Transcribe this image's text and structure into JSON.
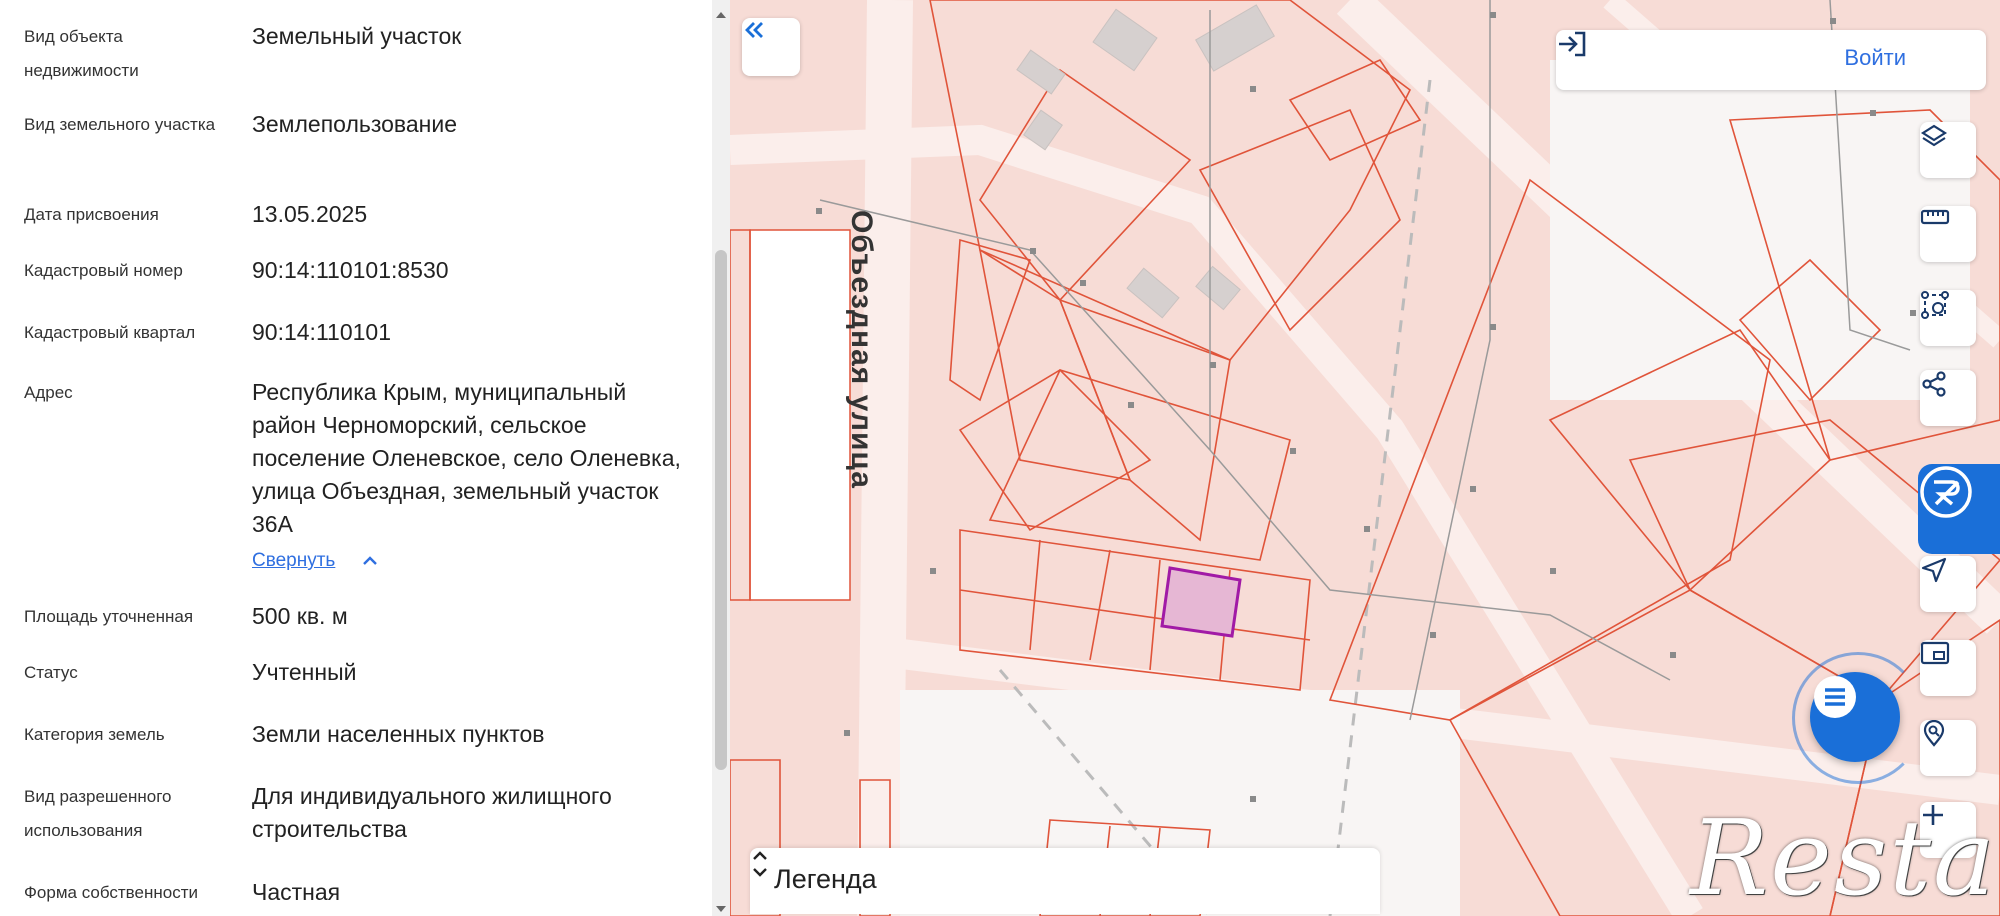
{
  "panel": {
    "rows": [
      {
        "label": "Вид объекта недвижимости",
        "value": "Земельный участок"
      },
      {
        "label": "Вид земельного участка",
        "value": "Землепользование"
      },
      {
        "label": "Дата присвоения",
        "value": "13.05.2025"
      },
      {
        "label": "Кадастровый номер",
        "value": "90:14:110101:8530"
      },
      {
        "label": "Кадастровый квартал",
        "value": "90:14:110101"
      },
      {
        "label": "Адрес",
        "value": "Республика Крым, муниципальный район Черноморский, сельское поселение Оленевское, село Оленевка, улица Объездная, земельный участок 36А"
      },
      {
        "label": "Площадь уточненная",
        "value": "500 кв. м"
      },
      {
        "label": "Статус",
        "value": "Учтенный"
      },
      {
        "label": "Категория земель",
        "value": "Земли населенных пунктов"
      },
      {
        "label": "Вид разрешенного использования",
        "value": "Для индивидуального жилищного строительства"
      },
      {
        "label": "Форма собственности",
        "value": "Частная"
      }
    ],
    "collapse_link": "Свернуть"
  },
  "map": {
    "street_name": "Объездная улица",
    "login_label": "Войти",
    "legend_label": "Легенда",
    "watermark": "Restate",
    "colors": {
      "parcel_fill": "#f6d3cc",
      "parcel_stroke": "#e0543a",
      "road": "#ffffff",
      "selected_fill": "#e6b7d4",
      "selected_stroke": "#a11aa6",
      "accent": "#1a6fd8",
      "link": "#2f6fe0"
    },
    "toolbar_icons": [
      "layers-icon",
      "ruler-icon",
      "area-select-icon",
      "share-icon",
      "geolocation-icon",
      "minimap-icon",
      "search-location-icon",
      "zoom-in-icon"
    ]
  }
}
